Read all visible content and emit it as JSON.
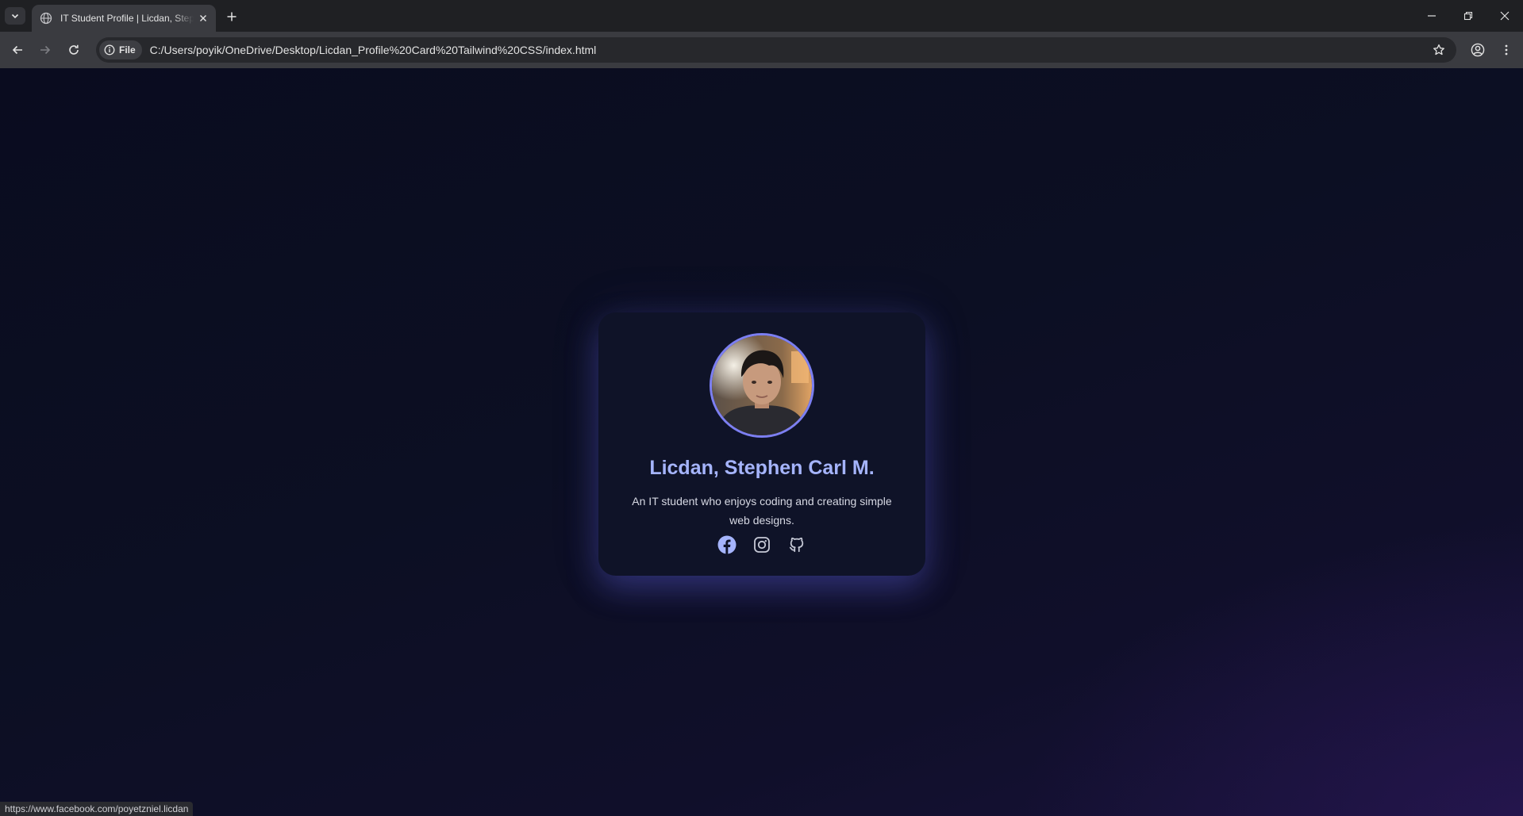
{
  "browser": {
    "tab": {
      "title": "IT Student Profile | Licdan, Stephen Carl M."
    },
    "omnibox": {
      "site_chip_label": "File",
      "url": "C:/Users/poyik/OneDrive/Desktop/Licdan_Profile%20Card%20Tailwind%20CSS/index.html"
    },
    "status_url": "https://www.facebook.com/poyetzniel.licdan"
  },
  "profile": {
    "name": "Licdan, Stephen Carl M.",
    "bio": "An IT student who enjoys coding and creating simple web designs.",
    "socials": [
      {
        "icon": "facebook-icon"
      },
      {
        "icon": "instagram-icon"
      },
      {
        "icon": "github-icon"
      }
    ]
  },
  "colors": {
    "accent": "#a5b4fc",
    "avatar_ring": "#7c7ff2",
    "card_bg": "#0f1328",
    "page_bg": "#0b0d1e"
  }
}
